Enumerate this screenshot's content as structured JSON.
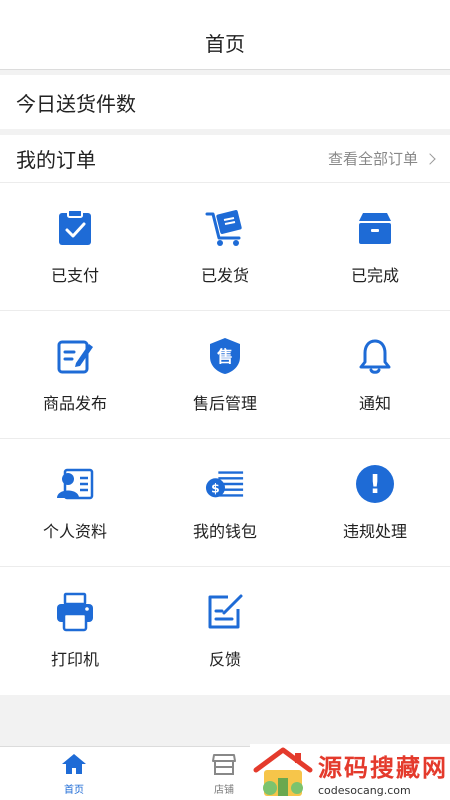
{
  "header": {
    "title": "首页"
  },
  "today": {
    "label": "今日送货件数"
  },
  "orders": {
    "title": "我的订单",
    "view_all": "查看全部订单"
  },
  "grid": {
    "items": [
      {
        "label": "已支付",
        "icon": "clipboard-check-icon"
      },
      {
        "label": "已发货",
        "icon": "cart-icon"
      },
      {
        "label": "已完成",
        "icon": "box-icon"
      },
      {
        "label": "商品发布",
        "icon": "edit-icon"
      },
      {
        "label": "售后管理",
        "icon": "shield-icon",
        "badge": "售"
      },
      {
        "label": "通知",
        "icon": "bell-icon"
      },
      {
        "label": "个人资料",
        "icon": "profile-card-icon"
      },
      {
        "label": "我的钱包",
        "icon": "wallet-icon",
        "badge": "$"
      },
      {
        "label": "违规处理",
        "icon": "alert-icon",
        "badge": "!"
      },
      {
        "label": "打印机",
        "icon": "printer-icon"
      },
      {
        "label": "反馈",
        "icon": "feedback-icon"
      }
    ]
  },
  "bottom_nav": {
    "tabs": [
      {
        "label": "首页",
        "icon": "home-icon",
        "active": true
      },
      {
        "label": "店铺",
        "icon": "store-icon",
        "active": false
      }
    ]
  },
  "watermark": {
    "title": "源码搜藏网",
    "url": "codesocang.com"
  },
  "colors": {
    "accent": "#1e6bd6",
    "background": "#f2f2f2",
    "watermark_red": "#e43a2c"
  }
}
